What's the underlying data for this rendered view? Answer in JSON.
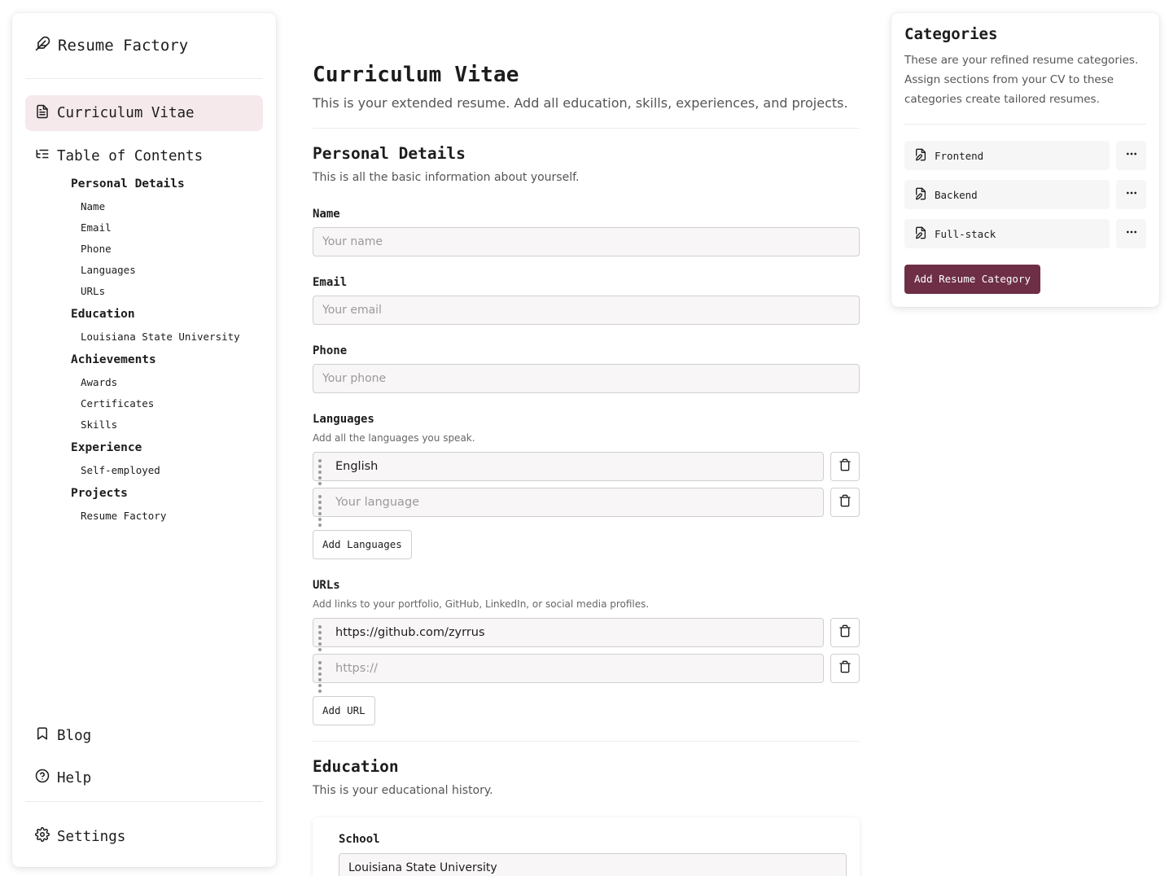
{
  "app": {
    "name": "Resume Factory"
  },
  "sidebar": {
    "active_item": "Curriculum Vitae",
    "toc_title": "Table of Contents",
    "toc": [
      {
        "label": "Personal Details",
        "children": [
          "Name",
          "Email",
          "Phone",
          "Languages",
          "URLs"
        ]
      },
      {
        "label": "Education",
        "children": [
          "Louisiana State University"
        ]
      },
      {
        "label": "Achievements",
        "children": [
          "Awards",
          "Certificates",
          "Skills"
        ]
      },
      {
        "label": "Experience",
        "children": [
          "Self-employed"
        ]
      },
      {
        "label": "Projects",
        "children": [
          "Resume Factory"
        ]
      }
    ],
    "blog": "Blog",
    "help": "Help",
    "settings": "Settings"
  },
  "main": {
    "title": "Curriculum Vitae",
    "subtitle": "This is your extended resume. Add all education, skills, experiences, and projects.",
    "personal": {
      "heading": "Personal Details",
      "description": "This is all the basic information about yourself.",
      "name_label": "Name",
      "name_placeholder": "Your name",
      "email_label": "Email",
      "email_placeholder": "Your email",
      "phone_label": "Phone",
      "phone_placeholder": "Your phone",
      "languages_label": "Languages",
      "languages_help": "Add all the languages you speak.",
      "languages": [
        "English"
      ],
      "language_placeholder": "Your language",
      "add_languages": "Add Languages",
      "urls_label": "URLs",
      "urls_help": "Add links to your portfolio, GitHub, LinkedIn, or social media profiles.",
      "urls": [
        "https://github.com/zyrrus"
      ],
      "url_placeholder": "https://",
      "add_url": "Add URL"
    },
    "education": {
      "heading": "Education",
      "description": "This is your educational history.",
      "school_label": "School",
      "school_value": "Louisiana State University"
    }
  },
  "categories": {
    "title": "Categories",
    "description": "These are your refined resume categories. Assign sections from your CV to these categories create tailored resumes.",
    "items": [
      "Frontend",
      "Backend",
      "Full-stack"
    ],
    "add_button": "Add Resume Category",
    "accent_color": "#6d2e46"
  }
}
